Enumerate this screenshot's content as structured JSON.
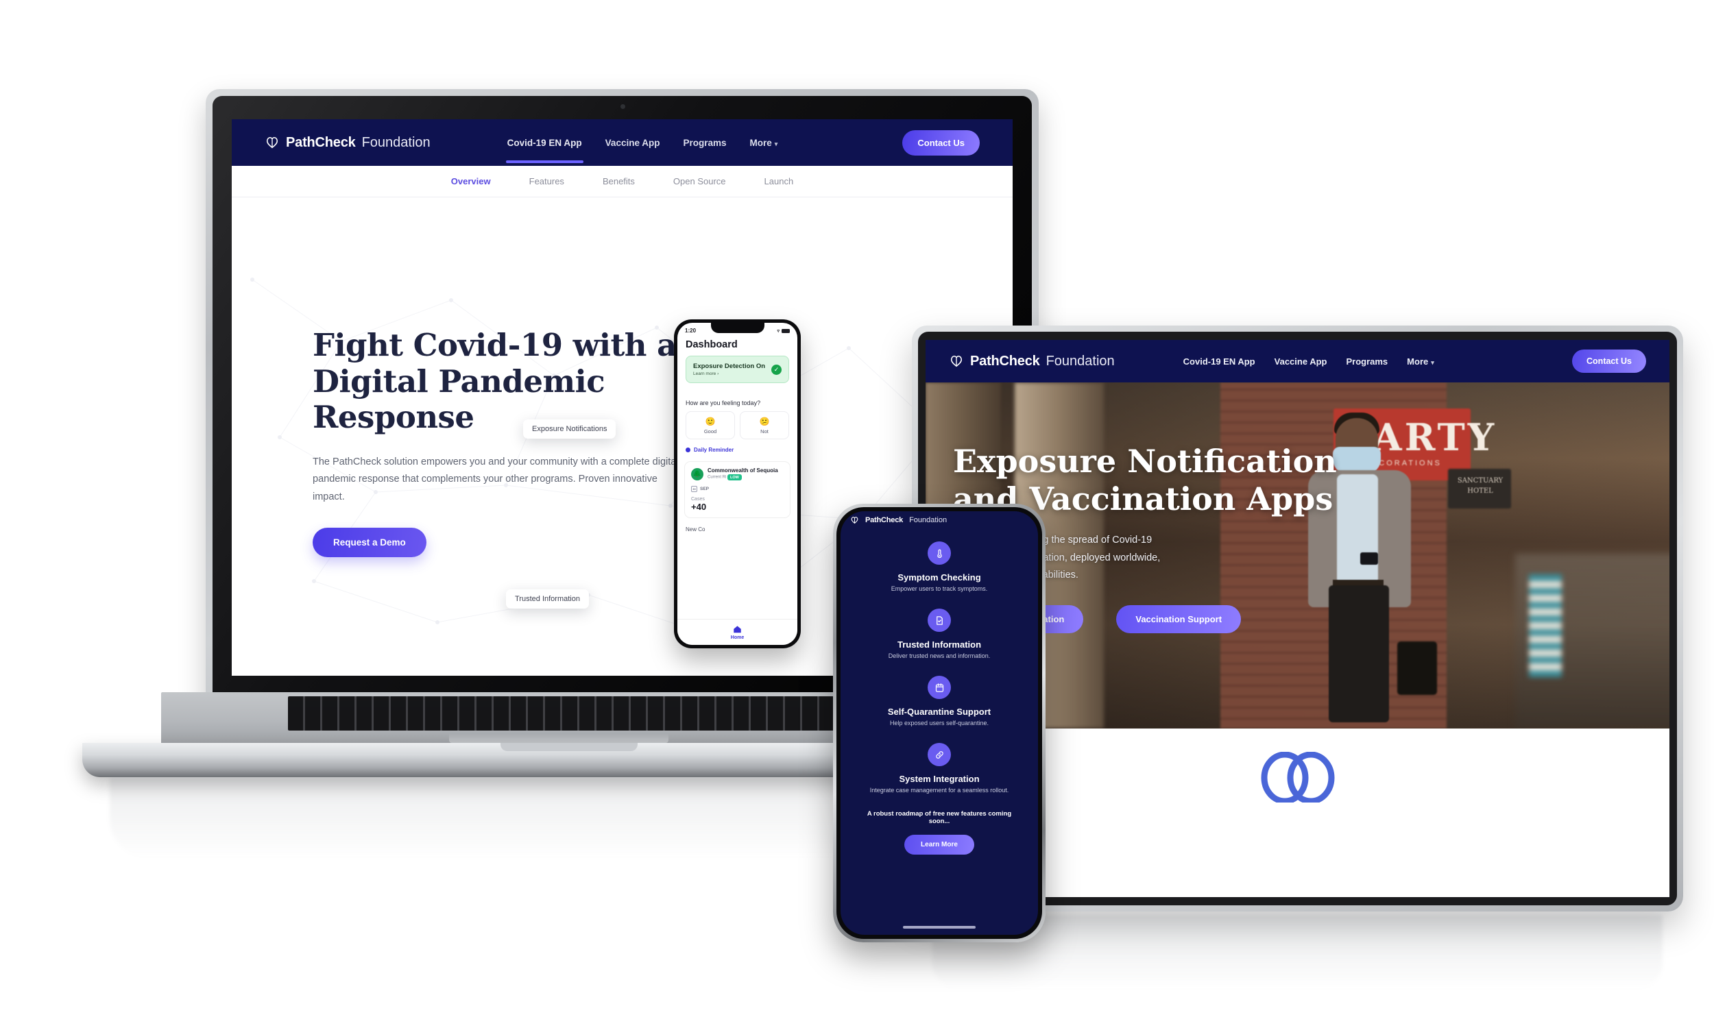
{
  "brand": {
    "name_bold": "PathCheck",
    "name_light": "Foundation",
    "logo_icon": "pathcheck-double-heart-logo"
  },
  "laptop_site": {
    "navbar": {
      "links": [
        {
          "label": "Covid-19 EN App",
          "active": true
        },
        {
          "label": "Vaccine App",
          "active": false
        },
        {
          "label": "Programs",
          "active": false
        },
        {
          "label": "More",
          "active": false,
          "has_caret": true
        }
      ],
      "cta_label": "Contact Us",
      "bg_color": "#0e1250",
      "accent_color": "#6c63ff"
    },
    "subnav": {
      "items": [
        {
          "label": "Overview",
          "active": true
        },
        {
          "label": "Features",
          "active": false
        },
        {
          "label": "Benefits",
          "active": false
        },
        {
          "label": "Open Source",
          "active": false
        },
        {
          "label": "Launch",
          "active": false
        }
      ]
    },
    "hero": {
      "headline": "Fight Covid-19 with a Digital Pandemic Response",
      "paragraph": "The PathCheck solution empowers you and your community with a complete digital pandemic response that complements your other programs. Proven innovative impact.",
      "button_label": "Request a Demo"
    },
    "tooltips": [
      {
        "label": "Exposure Notifications"
      },
      {
        "label": "Trusted Information"
      }
    ]
  },
  "dashboard_phone": {
    "status_time": "1:20",
    "status_wifi_icon": "wifi-icon",
    "status_battery_icon": "battery-icon",
    "title": "Dashboard",
    "exposure_card": {
      "title": "Exposure Detection On",
      "link_label": "Learn more",
      "link_chevron": "›",
      "status_icon": "check-circle-icon",
      "bg_color": "#ddf6e4",
      "check_color": "#16a34a"
    },
    "mood_prompt": "How are you feeling today?",
    "moods": [
      {
        "emoji": "🙂",
        "label": "Good"
      },
      {
        "emoji": "😕",
        "label": "Not"
      }
    ],
    "reminder_label": "Daily Reminder",
    "org_card": {
      "avatar_icon": "tree-icon",
      "name": "Commonwealth of Sequoia",
      "risk_label": "Current Ri",
      "risk_badge": "LOW",
      "date_icon": "calendar-icon",
      "date_label": "SEP",
      "cases_label": "Cases",
      "cases_value": "+40"
    },
    "new_section_label": "New Co",
    "tab_label": "Home",
    "tab_icon": "home-icon"
  },
  "tablet_site": {
    "navbar": {
      "links": [
        {
          "label": "Covid-19 EN App"
        },
        {
          "label": "Vaccine App"
        },
        {
          "label": "Programs"
        },
        {
          "label": "More",
          "has_caret": true
        }
      ],
      "cta_label": "Contact Us"
    },
    "hero": {
      "headline_line1": "Exposure Notification",
      "headline_line2": "and Vaccination Apps",
      "paragraph_line1": "Solutions for stopping the spread of Covid-19",
      "paragraph_line2": "with exposure notification, deployed worldwide,",
      "paragraph_line3": "plus vaccination capabilities.",
      "buttons": [
        {
          "label": "Exposure Notification"
        },
        {
          "label": "Vaccination Support"
        }
      ],
      "photo_sign_text": "PARTY",
      "photo_sign_sub": "DECORATIONS",
      "photo_shop_text": "SANCTUARY HOTEL",
      "photo_alt": "masked-pedestrian-on-city-street"
    },
    "footer_logo_icon": "pathcheck-double-ring-logo",
    "footer_logo_color": "#4a66d8"
  },
  "front_phone": {
    "header_bold": "PathCheck",
    "header_light": "Foundation",
    "features": [
      {
        "icon": "thermometer-icon",
        "title": "Symptom Checking",
        "desc": "Empower users to track symptoms."
      },
      {
        "icon": "document-check-icon",
        "title": "Trusted Information",
        "desc": "Deliver trusted news and information."
      },
      {
        "icon": "calendar-icon",
        "title": "Self-Quarantine Support",
        "desc": "Help exposed users self-quarantine."
      },
      {
        "icon": "link-icon",
        "title": "System Integration",
        "desc": "Integrate case management for a seamless rollout."
      }
    ],
    "roadmap_text": "A robust roadmap of free new features coming soon...",
    "learn_more_label": "Learn More",
    "screen_bg": "#0f1348",
    "icon_bg": "#6a5cf0"
  }
}
